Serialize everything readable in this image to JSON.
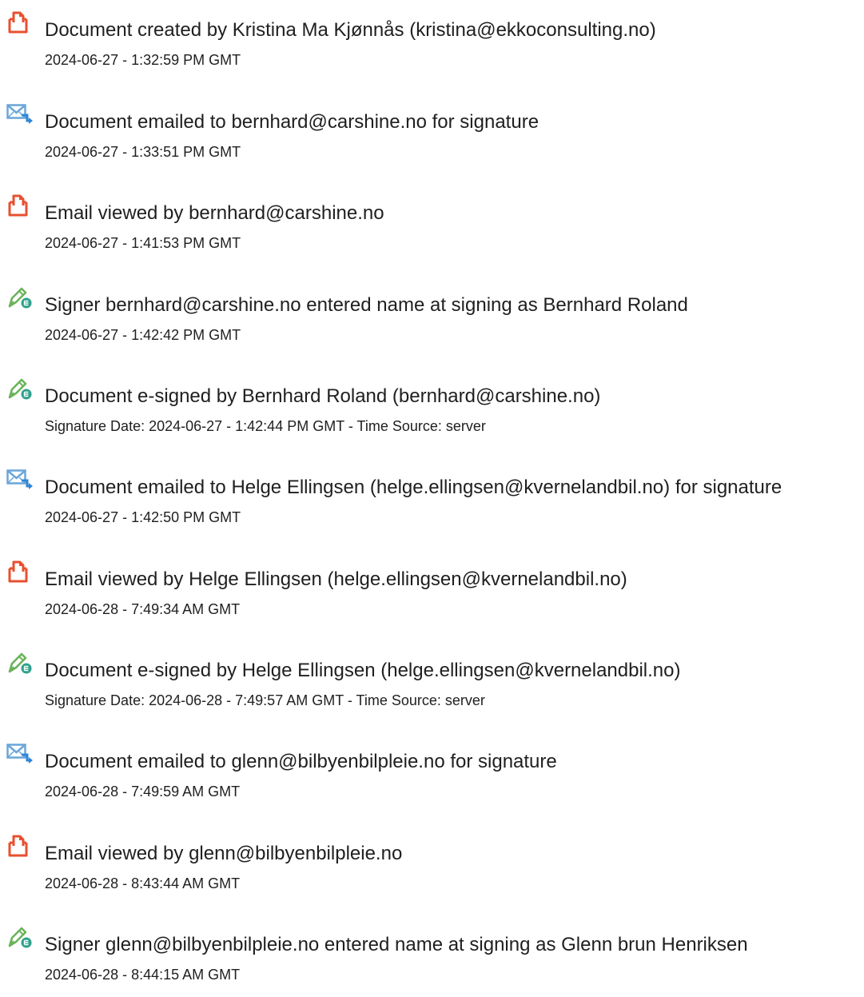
{
  "events": [
    {
      "icon": "document-created-icon",
      "text": "Document created by Kristina Ma Kjønnås (kristina@ekkoconsulting.no)",
      "detail": "2024-06-27 - 1:32:59 PM GMT"
    },
    {
      "icon": "email-sent-icon",
      "text": "Document emailed to bernhard@carshine.no for signature",
      "detail": "2024-06-27 - 1:33:51 PM GMT"
    },
    {
      "icon": "document-viewed-icon",
      "text": "Email viewed by bernhard@carshine.no",
      "detail": "2024-06-27 - 1:41:53 PM GMT"
    },
    {
      "icon": "pen-sign-icon",
      "text": "Signer bernhard@carshine.no entered name at signing as Bernhard Roland",
      "detail": "2024-06-27 - 1:42:42 PM GMT"
    },
    {
      "icon": "pen-sign-icon",
      "text": "Document e-signed by Bernhard Roland (bernhard@carshine.no)",
      "detail": "Signature Date: 2024-06-27 - 1:42:44 PM GMT - Time Source: server"
    },
    {
      "icon": "email-sent-icon",
      "text": "Document emailed to Helge Ellingsen (helge.ellingsen@kvernelandbil.no) for signature",
      "detail": "2024-06-27 - 1:42:50 PM GMT"
    },
    {
      "icon": "document-viewed-icon",
      "text": "Email viewed by Helge Ellingsen (helge.ellingsen@kvernelandbil.no)",
      "detail": "2024-06-28 - 7:49:34 AM GMT"
    },
    {
      "icon": "pen-sign-icon",
      "text": "Document e-signed by Helge Ellingsen (helge.ellingsen@kvernelandbil.no)",
      "detail": "Signature Date: 2024-06-28 - 7:49:57 AM GMT - Time Source: server"
    },
    {
      "icon": "email-sent-icon",
      "text": "Document emailed to glenn@bilbyenbilpleie.no for signature",
      "detail": "2024-06-28 - 7:49:59 AM GMT"
    },
    {
      "icon": "document-viewed-icon",
      "text": "Email viewed by glenn@bilbyenbilpleie.no",
      "detail": "2024-06-28 - 8:43:44 AM GMT"
    },
    {
      "icon": "pen-sign-icon",
      "text": "Signer glenn@bilbyenbilpleie.no entered name at signing as Glenn brun Henriksen",
      "detail": "2024-06-28 - 8:44:15 AM GMT"
    }
  ],
  "colors": {
    "document_icon": "#e8502f",
    "email_icon": "#6aa6d9",
    "email_arrow": "#2f86d6",
    "pen_icon": "#6bb35a",
    "pen_badge": "#2ea08a"
  }
}
